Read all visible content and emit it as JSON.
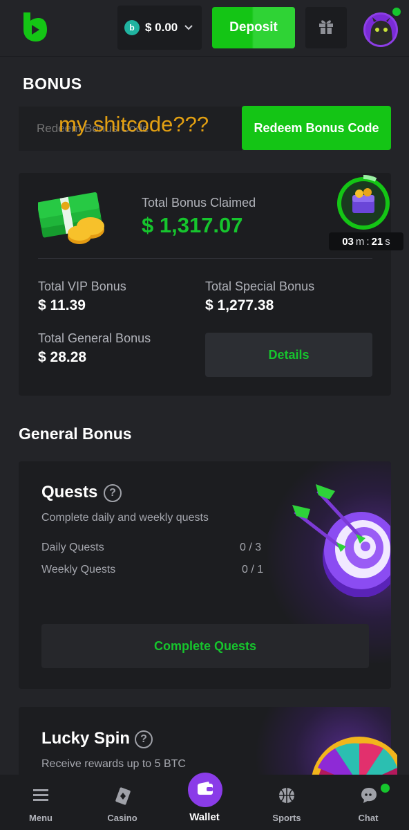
{
  "header": {
    "logo_icon": "bc-game-logo-icon",
    "balance": "$ 0.00",
    "coin_symbol": "b",
    "deposit_label": "Deposit",
    "gift_icon": "gift-icon",
    "avatar_icon": "avatar-icon",
    "colors": {
      "accent": "#14c515",
      "background": "#232428"
    }
  },
  "bonus": {
    "title": "BONUS",
    "redeem_placeholder": "Redeem Bonus Code",
    "overlay_note": "my shitcode???",
    "redeem_button": "Redeem Bonus Code"
  },
  "summary": {
    "claimed_label": "Total Bonus Claimed",
    "claimed_value": "$ 1,317.07",
    "timer": {
      "minutes": "03",
      "minutes_unit": "m",
      "seconds": "21",
      "seconds_unit": "s",
      "separator": ":"
    },
    "vip_label": "Total VIP Bonus",
    "vip_value": "$ 11.39",
    "special_label": "Total Special Bonus",
    "special_value": "$ 1,277.38",
    "general_label": "Total General Bonus",
    "general_value": "$ 28.28",
    "details_button": "Details"
  },
  "general_bonus": {
    "title": "General Bonus",
    "quests": {
      "title": "Quests",
      "help": "?",
      "subtitle": "Complete daily and weekly quests",
      "rows": [
        {
          "label": "Daily Quests",
          "value": "0 / 3"
        },
        {
          "label": "Weekly Quests",
          "value": "0 / 1"
        }
      ],
      "button": "Complete Quests"
    },
    "lucky_spin": {
      "title": "Lucky Spin",
      "help": "?",
      "subtitle": "Receive rewards up to 5 BTC"
    }
  },
  "bottom_nav": {
    "items": [
      {
        "label": "Menu",
        "icon": "menu-icon"
      },
      {
        "label": "Casino",
        "icon": "casino-icon"
      },
      {
        "label": "Wallet",
        "icon": "wallet-icon"
      },
      {
        "label": "Sports",
        "icon": "basketball-icon"
      },
      {
        "label": "Chat",
        "icon": "chat-icon"
      }
    ]
  }
}
